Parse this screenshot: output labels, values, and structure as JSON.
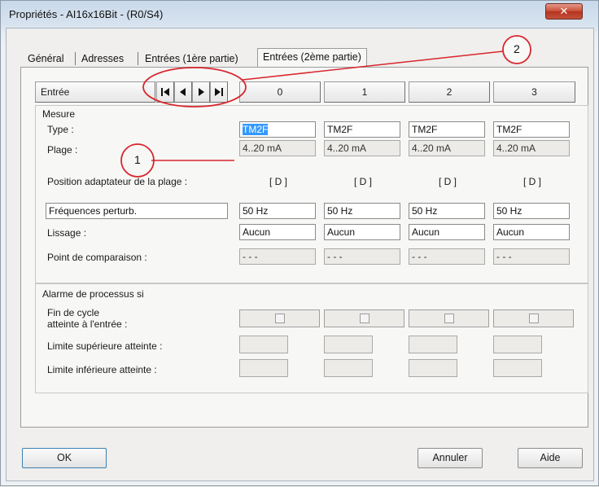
{
  "window": {
    "title": "Propriétés - AI16x16Bit - (R0/S4)",
    "close_glyph": "✕"
  },
  "tabs": [
    {
      "label": "Général"
    },
    {
      "label": "Adresses"
    },
    {
      "label": "Entrées (1ère partie)"
    },
    {
      "label": "Entrées (2ème partie)",
      "active": true
    }
  ],
  "header": {
    "entree_label": "Entrée",
    "channels": [
      "0",
      "1",
      "2",
      "3"
    ]
  },
  "mesure": {
    "section_label": "Mesure",
    "type_label": "Type :",
    "plage_label": "Plage :",
    "type_values": [
      "TM2F",
      "TM2F",
      "TM2F",
      "TM2F"
    ],
    "plage_values": [
      "4..20 mA",
      "4..20 mA",
      "4..20 mA",
      "4..20 mA"
    ],
    "position_label": "Position adaptateur de la plage :",
    "position_values": [
      "[ D ]",
      "[ D ]",
      "[ D ]",
      "[ D ]"
    ],
    "frequences_label": "Fréquences perturb.",
    "frequences_values": [
      "50 Hz",
      "50 Hz",
      "50 Hz",
      "50 Hz"
    ],
    "lissage_label": "Lissage :",
    "lissage_values": [
      "Aucun",
      "Aucun",
      "Aucun",
      "Aucun"
    ],
    "comparaison_label": "Point de comparaison :",
    "comparaison_values": [
      "- - -",
      "- - -",
      "- - -",
      "- - -"
    ]
  },
  "alarme": {
    "section_label": "Alarme de processus si",
    "fin_cycle_line1": "Fin de cycle",
    "fin_cycle_line2": "atteinte à l'entrée :",
    "limite_sup_label": "Limite supérieure atteinte :",
    "limite_inf_label": "Limite inférieure atteinte :"
  },
  "buttons": {
    "ok": "OK",
    "annuler": "Annuler",
    "aide": "Aide"
  },
  "annotations": {
    "callout_1": "1",
    "callout_2": "2",
    "color": "#d8262c"
  },
  "icons": {
    "nav": [
      "first-icon",
      "prev-icon",
      "next-icon",
      "last-icon"
    ]
  }
}
